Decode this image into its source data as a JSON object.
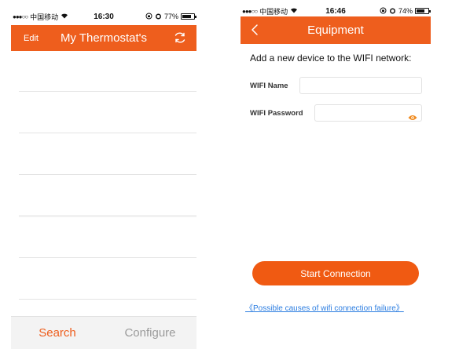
{
  "left_screen": {
    "status": {
      "carrier": "中国移动",
      "time": "16:30",
      "battery": "77%",
      "battery_level": 0.77
    },
    "header": {
      "edit_label": "Edit",
      "title": "My Thermostat's",
      "refresh_icon": "refresh-icon"
    },
    "tabs": [
      {
        "label": "Search",
        "active": true
      },
      {
        "label": "Configure",
        "active": false
      }
    ]
  },
  "right_screen": {
    "status": {
      "carrier": "中国移动",
      "time": "16:46",
      "battery": "74%",
      "battery_level": 0.74
    },
    "header": {
      "title": "Equipment",
      "back_icon": "chevron-left-icon"
    },
    "prompt": "Add a new device to the WIFI network:",
    "wifi_name": {
      "label": "WIFI Name",
      "value": "",
      "placeholder": ""
    },
    "wifi_password": {
      "label": "WIFI Password",
      "value": "",
      "placeholder": "",
      "toggle_icon": "eye-icon"
    },
    "connect_button": "Start Connection",
    "help_link": "《Possible causes of wifi connection failure》"
  },
  "colors": {
    "accent": "#ee5e1d",
    "link": "#2b7de1",
    "tab_inactive": "#9a9a9a"
  }
}
